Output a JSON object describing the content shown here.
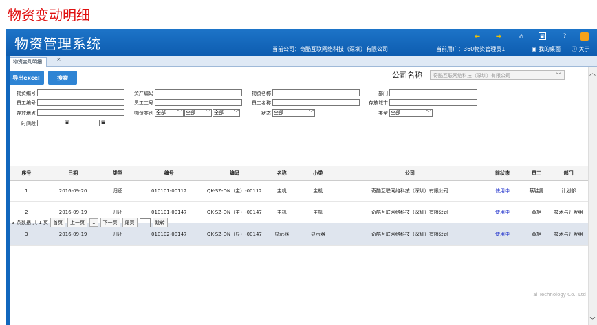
{
  "page_heading": "物资变动明细",
  "app": {
    "title": "物资管理系统",
    "company_text": "当前公司：奇酷互联网络科技（深圳）有限公司",
    "user_text": "当前用户：360物资管理员1",
    "my_desktop": "我的桌面",
    "about": "关于"
  },
  "tab": {
    "label": "物资变动明细",
    "close": "×"
  },
  "toolbar": {
    "export_label": "导出excel",
    "search_label": "搜索"
  },
  "company": {
    "label": "公司名称",
    "value": "奇酷互联网络科技（深圳）有限公司"
  },
  "filters": {
    "material_no": "物资编号",
    "asset_code": "资产编码",
    "material_name": "物资名称",
    "department": "部门",
    "employee_no": "员工编号",
    "employee_id": "员工工号",
    "employee_name": "员工名称",
    "storage_city": "存放城市",
    "storage_site": "存放地点",
    "material_category": "物资类别",
    "status": "状态",
    "type": "类型",
    "time_range": "时间段",
    "all": "全部"
  },
  "table": {
    "headers": [
      "序号",
      "日期",
      "类型",
      "编号",
      "编码",
      "名称",
      "小类",
      "公司",
      "前状态",
      "员工",
      "部门"
    ],
    "rows": [
      [
        "1",
        "2016-09-20",
        "归还",
        "010101-00112",
        "QK-SZ-DN（主）-00112",
        "主机",
        "主机",
        "奇酷互联网络科技（深圳）有限公司",
        "使用中",
        "蔡鞋男",
        "计划部"
      ],
      [
        "2",
        "2016-09-19",
        "归还",
        "010101-00147",
        "QK-SZ-DN（主）-00147",
        "主机",
        "主机",
        "奇酷互联网络科技（深圳）有限公司",
        "使用中",
        "黄旭",
        "技术与开发组"
      ],
      [
        "3",
        "2016-09-19",
        "归还",
        "010102-00147",
        "QK-SZ-DN（显）-00147",
        "显示器",
        "显示器",
        "奇酷互联网络科技（深圳）有限公司",
        "使用中",
        "黄旭",
        "技术与开发组"
      ]
    ]
  },
  "pager": {
    "summary": "共 3 条数据 共 1 页",
    "first": "首页",
    "prev": "上一页",
    "current": "1",
    "next": "下一页",
    "last": "尾页",
    "go": "跳转"
  },
  "footer": "ai Technology Co., Ltd"
}
